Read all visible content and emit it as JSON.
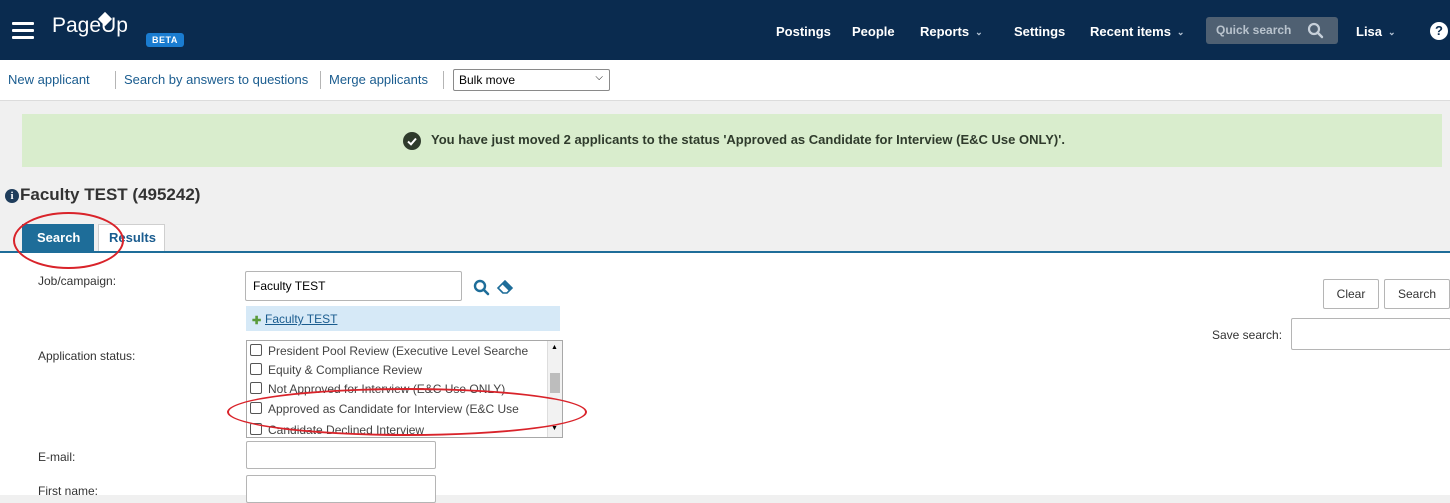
{
  "nav": {
    "brand": "PageUp",
    "beta": "BETA",
    "items": [
      {
        "label": "Postings",
        "dropdown": false
      },
      {
        "label": "People",
        "dropdown": false
      },
      {
        "label": "Reports",
        "dropdown": true
      },
      {
        "label": "Settings",
        "dropdown": false
      },
      {
        "label": "Recent items",
        "dropdown": true
      }
    ],
    "quick_search": "Quick search",
    "user": "Lisa",
    "help": "?"
  },
  "subbar": {
    "links": [
      "New applicant",
      "Search by answers to questions",
      "Merge applicants"
    ],
    "bulk_select": "Bulk move"
  },
  "banner": {
    "message": "You have just moved 2 applicants to the status 'Approved as Candidate for Interview (E&C Use ONLY)'."
  },
  "page": {
    "title": "Faculty TEST (495242)"
  },
  "tabs": {
    "search": "Search",
    "results": "Results"
  },
  "form": {
    "job_label": "Job/campaign:",
    "job_value": "Faculty TEST",
    "suggestion": "Faculty TEST",
    "status_label": "Application status:",
    "status_options": [
      "President Pool Review (Executive Level Searche",
      "Equity & Compliance Review",
      "Not Approved for Interview (E&C Use ONLY)",
      "Approved as Candidate for Interview (E&C Use",
      "Candidate Declined Interview"
    ],
    "email_label": "E-mail:",
    "firstname_label": "First name:",
    "clear_button": "Clear",
    "search_button": "Search",
    "save_search_label": "Save search:"
  },
  "colors": {
    "nav_bg": "#0a2b4f",
    "accent": "#1e6d99",
    "banner_bg": "#d9edcd",
    "annotation": "#d9232a"
  }
}
